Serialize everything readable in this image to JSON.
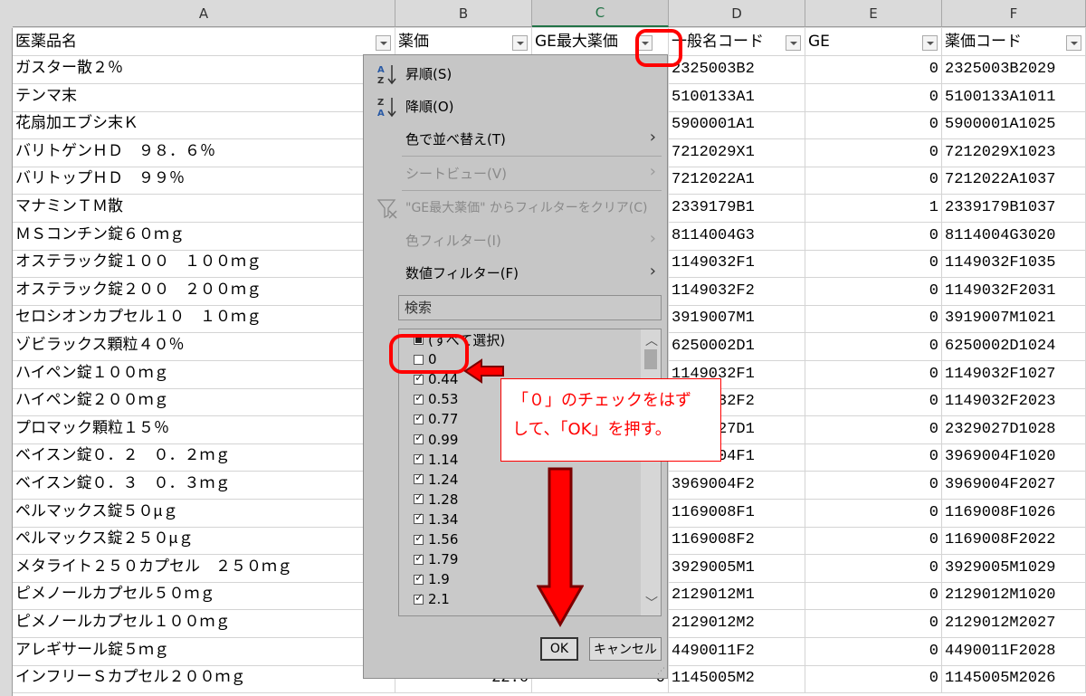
{
  "columns": [
    "A",
    "B",
    "C",
    "D",
    "E",
    "F"
  ],
  "header": {
    "a": "医薬品名",
    "b": "薬価",
    "c": "GE最大薬価",
    "d": "一般名コード",
    "e": "GE",
    "f": "薬価コード"
  },
  "rows": [
    {
      "a": "ガスター散２％",
      "b": "",
      "c": "",
      "d": "2325003B2",
      "e": "0",
      "f": "2325003B2029"
    },
    {
      "a": "テンマ末",
      "b": "",
      "c": "",
      "d": "5100133A1",
      "e": "0",
      "f": "5100133A1011"
    },
    {
      "a": "花扇加エブシ末Ｋ",
      "b": "",
      "c": "",
      "d": "5900001A1",
      "e": "0",
      "f": "5900001A1025"
    },
    {
      "a": "バリトゲンＨＤ　９８．６％",
      "b": "",
      "c": "",
      "d": "7212029X1",
      "e": "0",
      "f": "7212029X1023"
    },
    {
      "a": "バリトップＨＤ　９９％",
      "b": "",
      "c": "",
      "d": "7212022A1",
      "e": "0",
      "f": "7212022A1037"
    },
    {
      "a": "マナミンＴＭ散",
      "b": "",
      "c": "",
      "d": "2339179B1",
      "e": "1",
      "f": "2339179B1037"
    },
    {
      "a": "ＭＳコンチン錠６０ｍｇ",
      "b": "",
      "c": "",
      "d": "8114004G3",
      "e": "0",
      "f": "8114004G3020"
    },
    {
      "a": "オステラック錠１００　１００ｍｇ",
      "b": "",
      "c": "",
      "d": "1149032F1",
      "e": "0",
      "f": "1149032F1035"
    },
    {
      "a": "オステラック錠２００　２００ｍｇ",
      "b": "",
      "c": "",
      "d": "1149032F2",
      "e": "0",
      "f": "1149032F2031"
    },
    {
      "a": "セロシオンカプセル１０　１０ｍｇ",
      "b": "",
      "c": "",
      "d": "3919007M1",
      "e": "0",
      "f": "3919007M1021"
    },
    {
      "a": "ゾビラックス顆粒４０％",
      "b": "",
      "c": "",
      "d": "6250002D1",
      "e": "0",
      "f": "6250002D1024"
    },
    {
      "a": "ハイペン錠１００ｍｇ",
      "b": "",
      "c": "",
      "d": "1149032F1",
      "e": "0",
      "f": "1149032F1027"
    },
    {
      "a": "ハイペン錠２００ｍｇ",
      "b": "",
      "c": "",
      "d": "1149032F2",
      "e": "0",
      "f": "1149032F2023"
    },
    {
      "a": "プロマック顆粒１５％",
      "b": "",
      "c": "",
      "d": "2329027D1",
      "e": "0",
      "f": "2329027D1028"
    },
    {
      "a": "ベイスン錠０．２　０．２ｍｇ",
      "b": "",
      "c": "",
      "d": "3969004F1",
      "e": "0",
      "f": "3969004F1020"
    },
    {
      "a": "ベイスン錠０．３　０．３ｍｇ",
      "b": "",
      "c": "",
      "d": "3969004F2",
      "e": "0",
      "f": "3969004F2027"
    },
    {
      "a": "ペルマックス錠５０μｇ",
      "b": "",
      "c": "",
      "d": "1169008F1",
      "e": "0",
      "f": "1169008F1026"
    },
    {
      "a": "ペルマックス錠２５０μｇ",
      "b": "",
      "c": "",
      "d": "1169008F2",
      "e": "0",
      "f": "1169008F2022"
    },
    {
      "a": "メタライト２５０カプセル　２５０ｍｇ",
      "b": "",
      "c": "",
      "d": "3929005M1",
      "e": "0",
      "f": "3929005M1029"
    },
    {
      "a": "ピメノールカプセル５０ｍｇ",
      "b": "",
      "c": "",
      "d": "2129012M1",
      "e": "0",
      "f": "2129012M1020"
    },
    {
      "a": "ピメノールカプセル１００ｍｇ",
      "b": "",
      "c": "",
      "d": "2129012M2",
      "e": "0",
      "f": "2129012M2027"
    },
    {
      "a": "アレギサール錠５ｍｇ",
      "b": "",
      "c": "",
      "d": "4490011F2",
      "e": "0",
      "f": "4490011F2028"
    },
    {
      "a": "インフリーＳカプセル２００ｍｇ",
      "b": "22.6",
      "c": "0",
      "d": "1145005M2",
      "e": "0",
      "f": "1145005M2026"
    }
  ],
  "filter_menu": {
    "sort_asc": "昇順(S)",
    "sort_desc": "降順(O)",
    "sort_by_color": "色で並べ替え(T)",
    "sheet_view": "シートビュー(V)",
    "clear_filter": "\"GE最大薬価\" からフィルターをクリア(C)",
    "color_filter": "色フィルター(I)",
    "number_filter": "数値フィルター(F)",
    "search_placeholder": "検索",
    "items": [
      {
        "label": "(すべて選択)",
        "state": "partial"
      },
      {
        "label": "0",
        "state": "unchecked"
      },
      {
        "label": "0.44",
        "state": "checked"
      },
      {
        "label": "0.53",
        "state": "checked"
      },
      {
        "label": "0.77",
        "state": "checked"
      },
      {
        "label": "0.99",
        "state": "checked"
      },
      {
        "label": "1.14",
        "state": "checked"
      },
      {
        "label": "1.24",
        "state": "checked"
      },
      {
        "label": "1.28",
        "state": "checked"
      },
      {
        "label": "1.34",
        "state": "checked"
      },
      {
        "label": "1.56",
        "state": "checked"
      },
      {
        "label": "1.79",
        "state": "checked"
      },
      {
        "label": "1.9",
        "state": "checked"
      },
      {
        "label": "2.1",
        "state": "checked"
      }
    ],
    "ok": "OK",
    "cancel": "キャンセル"
  },
  "annotation": {
    "line1": "「０」のチェックをはず",
    "line2": "して、「OK」を押す。",
    "color": "#ff0000"
  }
}
